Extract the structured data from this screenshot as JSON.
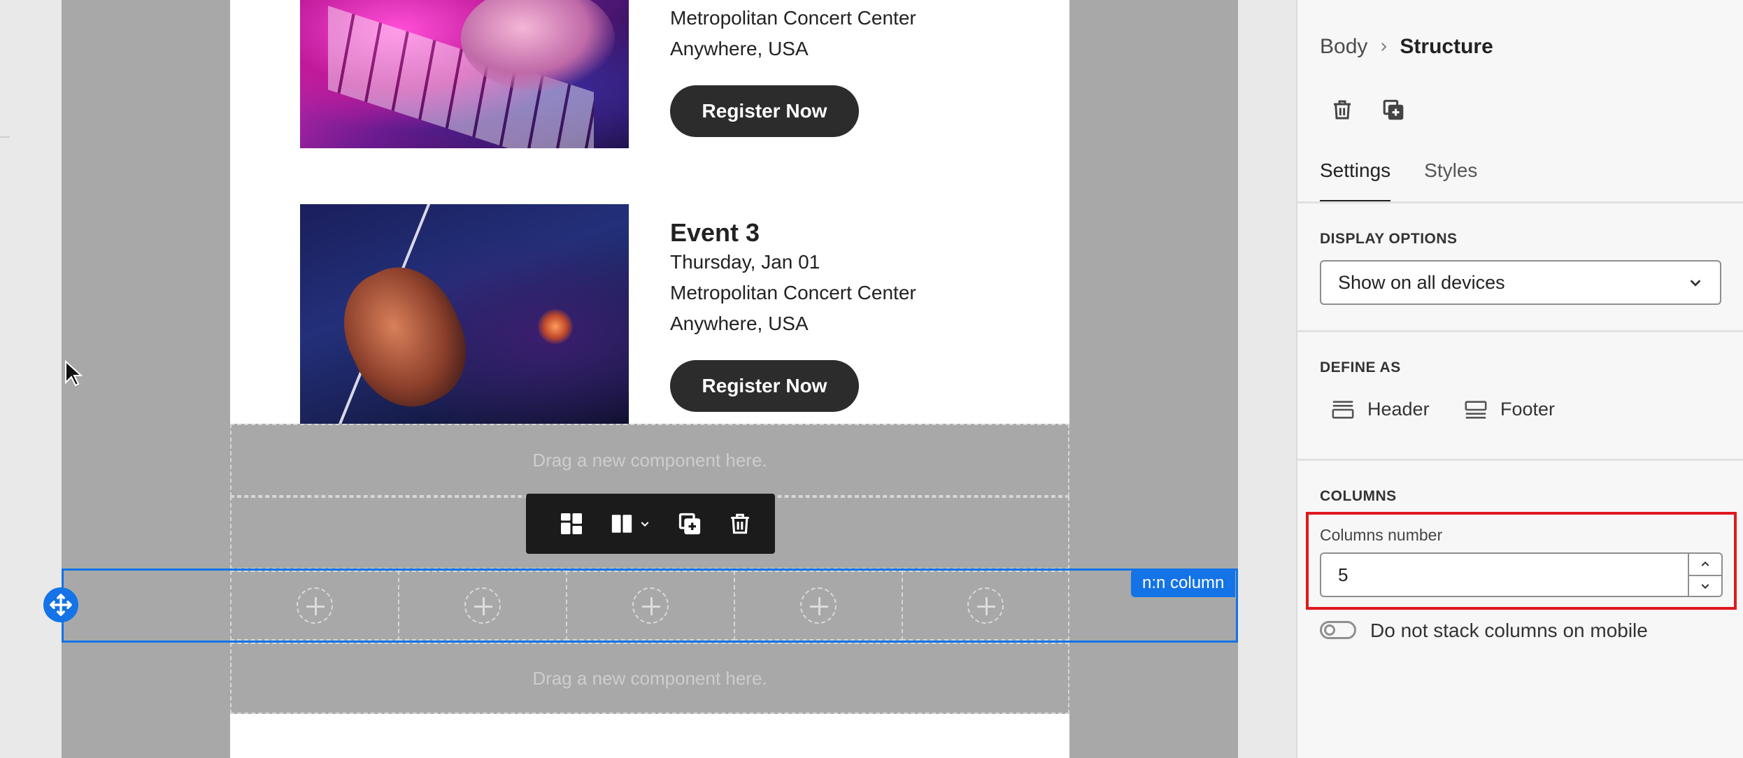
{
  "canvas": {
    "events": [
      {
        "title": "",
        "venue": "Metropolitan Concert Center",
        "location": "Anywhere, USA",
        "button": "Register Now"
      },
      {
        "title": "Event 3",
        "date": "Thursday, Jan 01",
        "venue": "Metropolitan Concert Center",
        "location": "Anywhere, USA",
        "button": "Register Now"
      }
    ],
    "dropzone_text": "Drag a new component here.",
    "selected_row": {
      "label": "n:n column",
      "column_count": 5
    },
    "toolbar": {
      "icons": [
        "grid-layout-icon",
        "column-layout-icon",
        "duplicate-icon",
        "delete-icon"
      ]
    }
  },
  "panel": {
    "breadcrumb": {
      "parent": "Body",
      "current": "Structure"
    },
    "tabs": [
      "Settings",
      "Styles"
    ],
    "active_tab": "Settings",
    "display_options": {
      "title": "DISPLAY OPTIONS",
      "value": "Show on all devices"
    },
    "define_as": {
      "title": "DEFINE AS",
      "header_label": "Header",
      "footer_label": "Footer"
    },
    "columns": {
      "title": "COLUMNS",
      "field_label": "Columns number",
      "value": "5",
      "stack_toggle_label": "Do not stack columns on mobile",
      "stack_toggle_on": false
    }
  },
  "colors": {
    "accent": "#1473e6",
    "highlight": "#e0191e",
    "canvas_bg": "#a8a8a8",
    "button_dark": "#2c2c2c"
  }
}
